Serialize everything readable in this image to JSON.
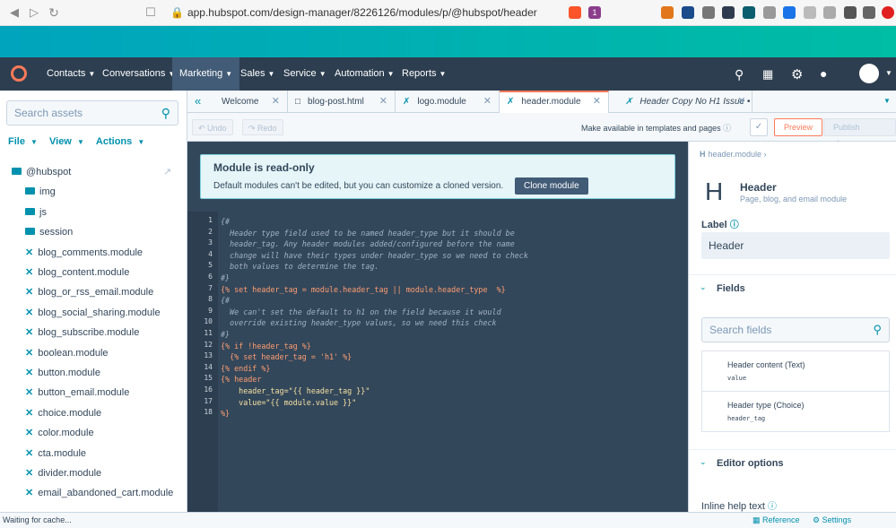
{
  "browser": {
    "url": "app.hubspot.com/design-manager/8226126/modules/p/@hubspot/header",
    "badge": "1"
  },
  "nav": {
    "items": [
      "Contacts",
      "Conversations",
      "Marketing",
      "Sales",
      "Service",
      "Automation",
      "Reports"
    ],
    "active": "Marketing"
  },
  "sidebar": {
    "search_placeholder": "Search assets",
    "actions": [
      "File",
      "View",
      "Actions"
    ],
    "root": "@hubspot",
    "folders": [
      "img",
      "js",
      "session"
    ],
    "modules": [
      "blog_comments.module",
      "blog_content.module",
      "blog_or_rss_email.module",
      "blog_social_sharing.module",
      "blog_subscribe.module",
      "boolean.module",
      "button.module",
      "button_email.module",
      "choice.module",
      "color.module",
      "cta.module",
      "divider.module",
      "email_abandoned_cart.module"
    ]
  },
  "tabs": [
    {
      "label": "Welcome"
    },
    {
      "label": "blog-post.html"
    },
    {
      "label": "logo.module"
    },
    {
      "label": "header.module"
    },
    {
      "label": "Header Copy No H1 Issue •"
    }
  ],
  "toolbar": {
    "undo": "Undo",
    "redo": "Redo",
    "make_available": "Make available in templates and pages",
    "preview": "Preview",
    "publish": "Publish changes"
  },
  "banner": {
    "title": "Module is read-only",
    "text": "Default modules can't be edited, but you can customize a cloned version.",
    "button": "Clone module"
  },
  "code_lines": [
    "{#",
    "  Header type field used to be named header_type but it should be",
    "  header_tag. Any header modules added/configured before the name",
    "  change will have their types under header_type so we need to check",
    "  both values to determine the tag.",
    "#}",
    "{% set header_tag = module.header_tag || module.header_type  %}",
    "{#",
    "  We can't set the default to h1 on the field because it would",
    "  override existing header_type values, so we need this check",
    "#}",
    "{% if !header_tag %}",
    "  {% set header_tag = 'h1' %}",
    "{% endif %}",
    "{% header",
    "    header_tag=\"{{ header_tag }}\"",
    "    value=\"{{ module.value }}\"",
    "%}"
  ],
  "line_kinds": [
    "com",
    "com",
    "com",
    "com",
    "com",
    "com",
    "kw",
    "com",
    "com",
    "com",
    "com",
    "kw",
    "kw",
    "kw",
    "kw",
    "str",
    "str",
    "kw"
  ],
  "panel": {
    "breadcrumb": "header.module",
    "module_letter": "H",
    "module_name": "Header",
    "module_desc": "Page, blog, and email module",
    "label_title": "Label",
    "label_value": "Header",
    "fields_title": "Fields",
    "search_fields": "Search fields",
    "fields": [
      {
        "name": "Header content (Text)",
        "key": "value"
      },
      {
        "name": "Header type (Choice)",
        "key": "header_tag"
      }
    ],
    "editor_options": "Editor options",
    "inline_help": "Inline help text"
  },
  "status": {
    "text": "Waiting for cache...",
    "reference": "Reference",
    "settings": "Settings"
  },
  "colors": {
    "teal": "#00a4bd",
    "nav": "#2d3e50",
    "accent": "#ff7a59",
    "link": "#0091ae"
  }
}
